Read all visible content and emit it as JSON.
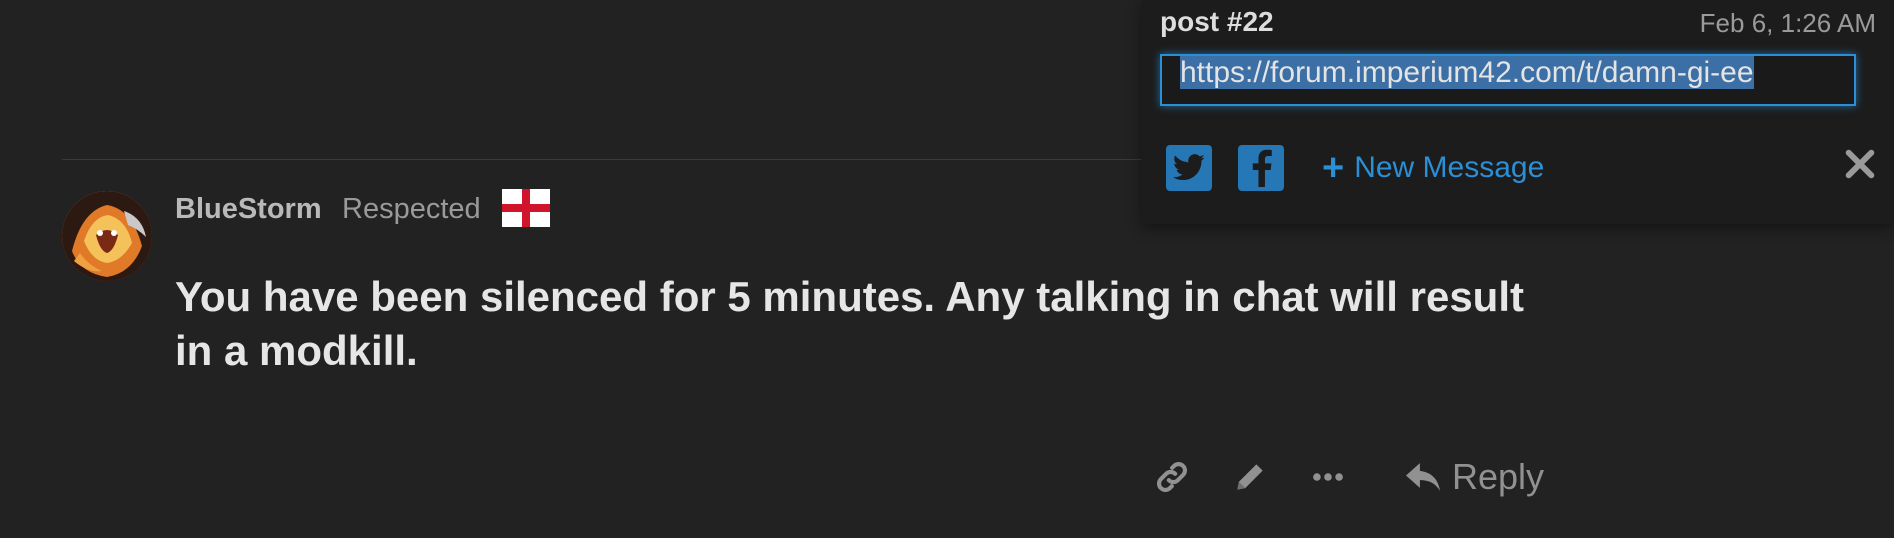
{
  "post": {
    "username": "BlueStorm",
    "user_title": "Respected",
    "flag": "england-flag",
    "body": "You have been silenced for 5 minutes. Any talking in chat will result in a modkill.",
    "actions": {
      "link_icon": "link-icon",
      "edit_icon": "pencil-icon",
      "more_icon": "more-icon",
      "reply_label": "Reply"
    }
  },
  "share": {
    "title": "post #22",
    "date": "Feb 6, 1:26 AM",
    "url": "https://forum.imperium42.com/t/damn-gi-ee",
    "twitter_icon": "twitter-icon",
    "facebook_icon": "facebook-icon",
    "new_message_label": "New Message",
    "close_icon": "close-icon"
  },
  "colors": {
    "background": "#222222",
    "accent": "#2b8fd6",
    "text_primary": "#e6e6e6",
    "text_muted": "#919191"
  }
}
